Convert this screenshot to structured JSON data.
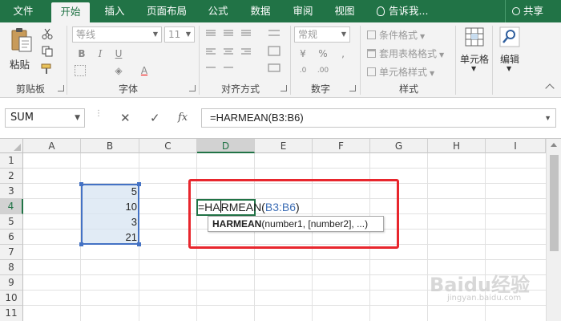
{
  "tabs": [
    "文件",
    "开始",
    "插入",
    "页面布局",
    "公式",
    "数据",
    "审阅",
    "视图"
  ],
  "active_tab": "开始",
  "tell_me": "告诉我...",
  "share": "共享",
  "ribbon": {
    "clipboard": {
      "paste_label": "粘贴",
      "group_label": "剪贴板"
    },
    "font": {
      "font_name": "等线",
      "font_size": "11",
      "group_label": "字体"
    },
    "alignment": {
      "group_label": "对齐方式"
    },
    "number": {
      "format": "常规",
      "group_label": "数字"
    },
    "styles": {
      "conditional_format": "条件格式",
      "table_format": "套用表格格式",
      "cell_style": "单元格样式",
      "group_label": "样式"
    },
    "cells": {
      "label": "单元格"
    },
    "editing": {
      "label": "编辑"
    }
  },
  "formula_bar": {
    "name_box": "SUM",
    "formula": "=HARMEAN(B3:B6)",
    "fx": "fx"
  },
  "sheet": {
    "columns": [
      "A",
      "B",
      "C",
      "D",
      "E",
      "F",
      "G",
      "H",
      "I"
    ],
    "rows": [
      "1",
      "2",
      "3",
      "4",
      "5",
      "6",
      "7",
      "8",
      "9",
      "10",
      "11"
    ],
    "values": {
      "B3": "5",
      "B4": "10",
      "B5": "3",
      "B6": "21"
    },
    "edit_prefix": "=HA",
    "edit_suffix": "RMEAN(",
    "edit_ref": "B3:B6",
    "edit_close": ")",
    "tooltip_fn": "HARMEAN",
    "tooltip_args": "(number1, [number2], ...)"
  },
  "colors": {
    "excel_green": "#217346",
    "range_blue": "#4472c4",
    "ref_blue": "#3f6fb6",
    "highlight_red": "#e8262d"
  },
  "watermark": {
    "text": "Baidu经验",
    "sub": "jingyan.baidu.com"
  }
}
